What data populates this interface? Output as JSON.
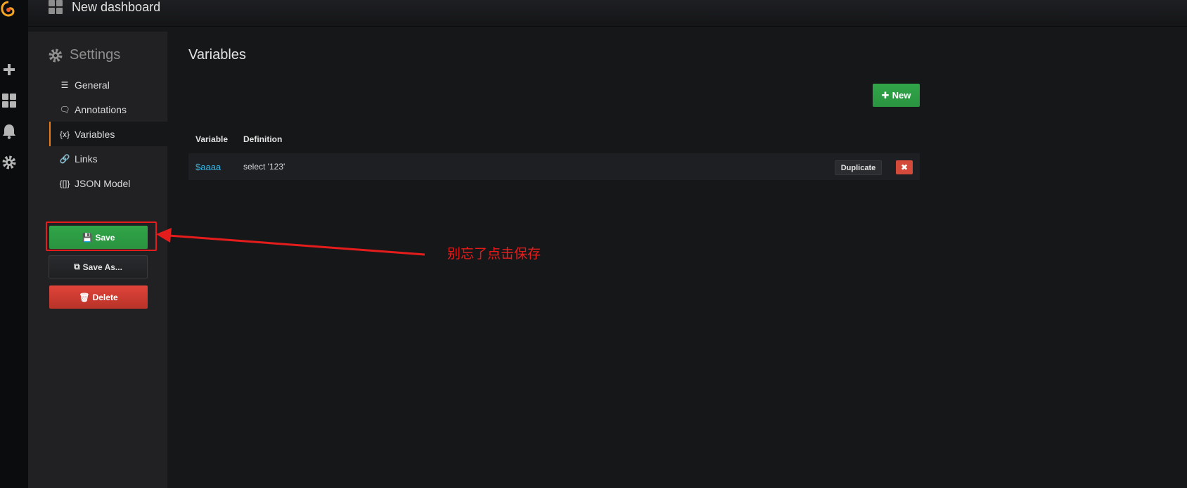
{
  "topbar": {
    "title": "New dashboard"
  },
  "settings": {
    "title": "Settings",
    "nav": [
      {
        "label": "General",
        "icon": "sliders-icon",
        "glyph": "☰",
        "active": false
      },
      {
        "label": "Annotations",
        "icon": "comment-icon",
        "glyph": "🗨",
        "active": false
      },
      {
        "label": "Variables",
        "icon": "variable-icon",
        "glyph": "{x}",
        "active": true
      },
      {
        "label": "Links",
        "icon": "link-icon",
        "glyph": "🔗",
        "active": false
      },
      {
        "label": "JSON Model",
        "icon": "json-icon",
        "glyph": "{[]}",
        "active": false
      }
    ],
    "save_label": "Save",
    "save_as_label": "Save As...",
    "delete_label": "Delete"
  },
  "main": {
    "title": "Variables",
    "new_label": "New",
    "columns": [
      "Variable",
      "Definition"
    ],
    "rows": [
      {
        "variable": "$aaaa",
        "definition": "select '123'",
        "duplicate_label": "Duplicate",
        "remove_glyph": "✖"
      }
    ]
  },
  "annotation": {
    "text": "别忘了点击保存"
  },
  "colors": {
    "accent": "#eb7b18",
    "success": "#31a548",
    "danger": "#d44a3a",
    "link": "#33b5e5",
    "annotation": "#e51c1c"
  }
}
